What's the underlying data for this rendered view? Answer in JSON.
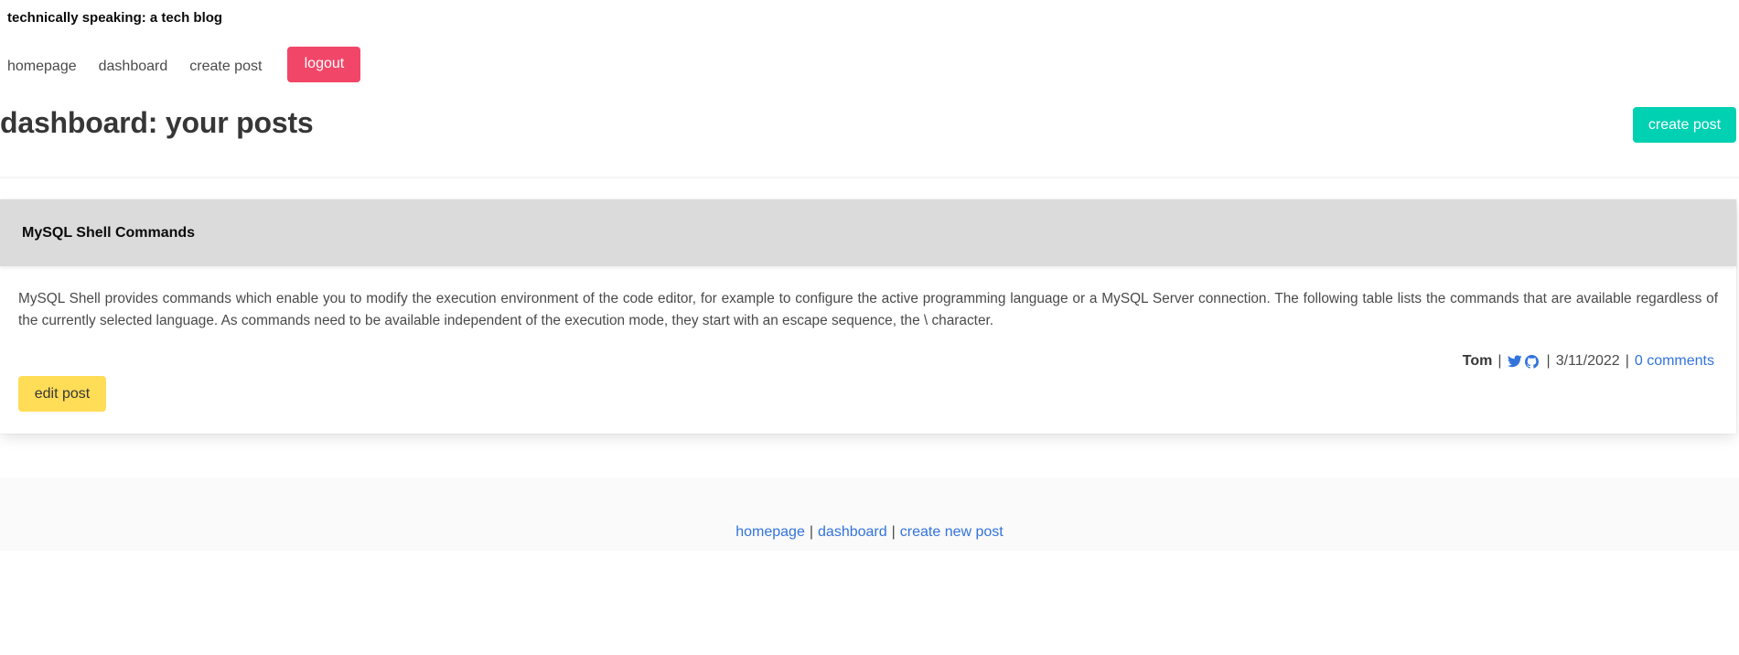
{
  "site": {
    "title": "technically speaking: a tech blog"
  },
  "nav": {
    "homepage": "homepage",
    "dashboard": "dashboard",
    "create_post": "create post",
    "logout": "logout"
  },
  "main": {
    "heading": "dashboard: your posts",
    "create_button": "create post"
  },
  "post": {
    "title": "MySQL Shell Commands",
    "body": "MySQL Shell provides commands which enable you to modify the execution environment of the code editor, for example to configure the active programming language or a MySQL Server connection. The following table lists the commands that are available regardless of the currently selected language. As commands need to be available independent of the execution mode, they start with an escape sequence, the \\ character.",
    "author": "Tom",
    "separator": "|",
    "date": "3/11/2022",
    "comments": "0 comments",
    "edit_button": "edit post",
    "icons": [
      "twitter-icon",
      "github-icon"
    ]
  },
  "footer": {
    "homepage": "homepage",
    "dashboard": "dashboard",
    "create_new_post": "create new post",
    "separator": "|"
  },
  "colors": {
    "logout": "#f14668",
    "create": "#00d1b2",
    "edit": "#ffdd57",
    "link": "#3273dc",
    "card_header": "#dbdbdb"
  }
}
